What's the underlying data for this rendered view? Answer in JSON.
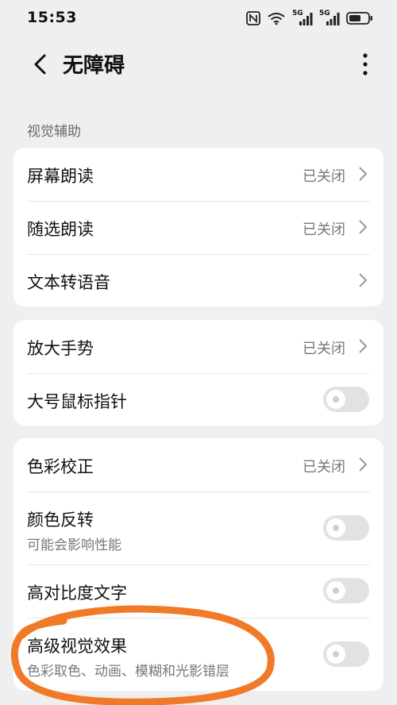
{
  "status_bar": {
    "time": "15:53",
    "net1": "5G",
    "net2": "5G",
    "icons": [
      "nfc-icon",
      "wifi-icon",
      "signal-5g-icon",
      "signal-5g-icon",
      "battery-icon"
    ]
  },
  "header": {
    "title": "无障碍"
  },
  "section": {
    "label": "视觉辅助"
  },
  "groups": [
    {
      "rows": [
        {
          "label": "屏幕朗读",
          "value": "已关闭"
        },
        {
          "label": "随选朗读",
          "value": "已关闭"
        },
        {
          "label": "文本转语音",
          "value": ""
        }
      ]
    },
    {
      "rows": [
        {
          "label": "放大手势",
          "value": "已关闭"
        },
        {
          "label": "大号鼠标指针",
          "toggle": false
        }
      ]
    },
    {
      "rows": [
        {
          "label": "色彩校正",
          "value": "已关闭"
        },
        {
          "label": "颜色反转",
          "sub": "可能会影响性能",
          "toggle": false
        },
        {
          "label": "高对比度文字",
          "toggle": false
        },
        {
          "label": "高级视觉效果",
          "sub": "色彩取色、动画、模糊和光影错层",
          "toggle": false
        }
      ]
    }
  ],
  "colors": {
    "background": "#efefef",
    "card": "#ffffff",
    "annotation": "#f07a28"
  }
}
